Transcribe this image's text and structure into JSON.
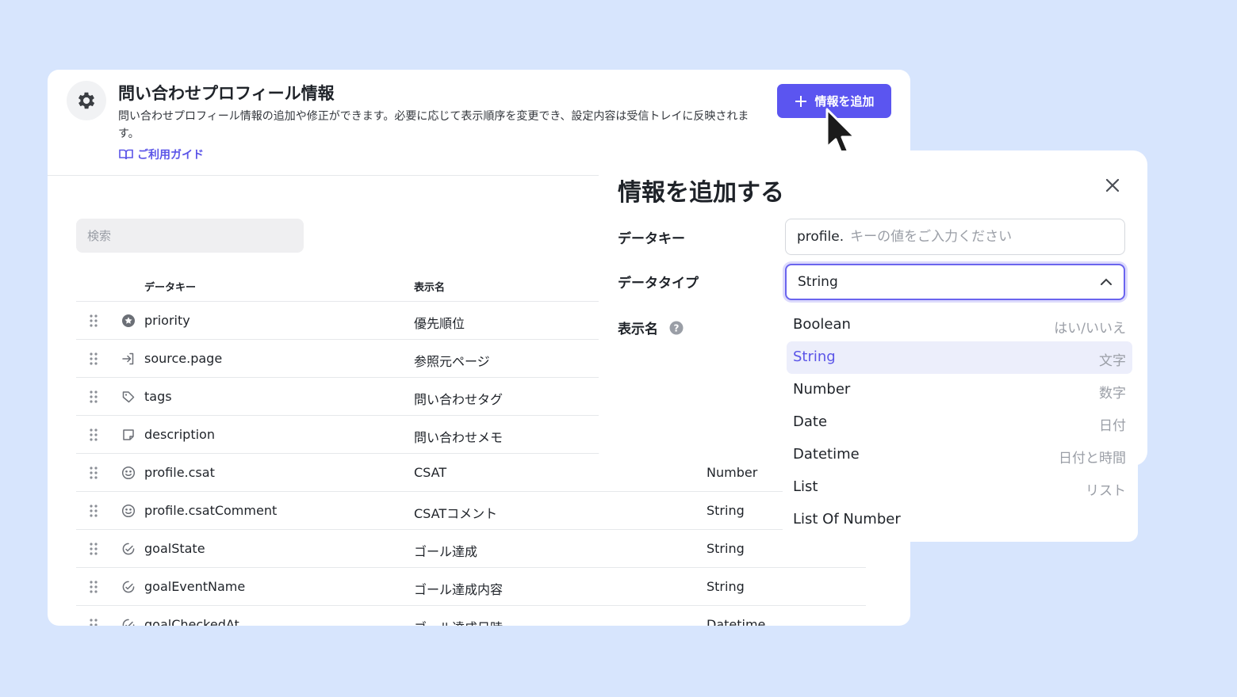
{
  "header": {
    "title": "問い合わせプロフィール情報",
    "description": "問い合わせプロフィール情報の追加や修正ができます。必要に応じて表示順序を変更でき、設定内容は受信トレイに反映されます。",
    "guide_link": "ご利用ガイド",
    "add_button": "情報を追加"
  },
  "search": {
    "placeholder": "検索"
  },
  "table": {
    "columns": {
      "key": "データキー",
      "display": "表示名"
    },
    "rows": [
      {
        "key": "priority",
        "display": "優先順位",
        "type": "",
        "icon": "priority-icon"
      },
      {
        "key": "source.page",
        "display": "参照元ページ",
        "type": "",
        "icon": "login-arrow-icon"
      },
      {
        "key": "tags",
        "display": "問い合わせタグ",
        "type": "",
        "icon": "tag-icon"
      },
      {
        "key": "description",
        "display": "問い合わせメモ",
        "type": "",
        "icon": "note-icon"
      },
      {
        "key": "profile.csat",
        "display": "CSAT",
        "type": "Number",
        "icon": "smiley-icon"
      },
      {
        "key": "profile.csatComment",
        "display": "CSATコメント",
        "type": "String",
        "icon": "smiley-icon"
      },
      {
        "key": "goalState",
        "display": "ゴール達成",
        "type": "String",
        "icon": "goal-icon"
      },
      {
        "key": "goalEventName",
        "display": "ゴール達成内容",
        "type": "String",
        "icon": "goal-icon"
      },
      {
        "key": "goalCheckedAt",
        "display": "ゴール達成日時",
        "type": "Datetime",
        "icon": "goal-icon"
      }
    ]
  },
  "panel": {
    "title": "情報を追加する",
    "data_key_label": "データキー",
    "data_key_prefix": "profile.",
    "data_key_placeholder": "キーの値をご入力ください",
    "data_type_label": "データタイプ",
    "data_type_value": "String",
    "display_name_label": "表示名"
  },
  "dropdown": {
    "options": [
      {
        "label": "Boolean",
        "desc": "はい/いいえ",
        "selected": false
      },
      {
        "label": "String",
        "desc": "文字",
        "selected": true
      },
      {
        "label": "Number",
        "desc": "数字",
        "selected": false
      },
      {
        "label": "Date",
        "desc": "日付",
        "selected": false
      },
      {
        "label": "Datetime",
        "desc": "日付と時間",
        "selected": false
      },
      {
        "label": "List",
        "desc": "リスト",
        "selected": false
      },
      {
        "label": "List Of Number",
        "desc": "",
        "selected": false
      }
    ]
  },
  "colors": {
    "accent": "#5b55f0",
    "background": "#d7e5fd",
    "selected_bg": "#eceefb"
  }
}
